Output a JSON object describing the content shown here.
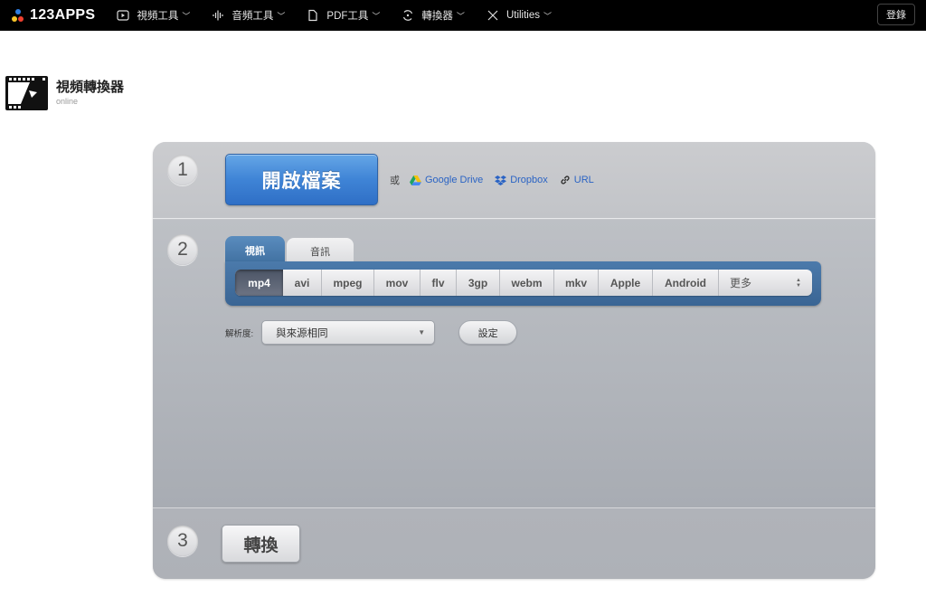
{
  "topbar": {
    "logo_text": "123APPS",
    "nav": [
      {
        "label": "視頻工具",
        "icon": "play-icon"
      },
      {
        "label": "音頻工具",
        "icon": "waveform-icon"
      },
      {
        "label": "PDF工具",
        "icon": "document-icon"
      },
      {
        "label": "轉換器",
        "icon": "convert-icon"
      },
      {
        "label": "Utilities",
        "icon": "tools-icon"
      }
    ],
    "login_label": "登錄"
  },
  "app": {
    "title": "視頻轉換器",
    "subtitle": "online"
  },
  "step1": {
    "number": "1",
    "open_label": "開啟檔案",
    "or_label": "或",
    "sources": [
      {
        "label": "Google Drive",
        "icon": "google-drive-icon"
      },
      {
        "label": "Dropbox",
        "icon": "dropbox-icon"
      },
      {
        "label": "URL",
        "icon": "link-icon"
      }
    ]
  },
  "step2": {
    "number": "2",
    "tabs": [
      {
        "label": "視訊",
        "active": true
      },
      {
        "label": "音訊",
        "active": false
      }
    ],
    "formats": [
      "mp4",
      "avi",
      "mpeg",
      "mov",
      "flv",
      "3gp",
      "webm",
      "mkv",
      "Apple",
      "Android"
    ],
    "active_format": "mp4",
    "more_label": "更多",
    "resolution_label": "解析度:",
    "resolution_value": "與來源相同",
    "settings_label": "設定"
  },
  "step3": {
    "number": "3",
    "convert_label": "轉換"
  },
  "colors": {
    "accent_blue": "#3f84d6",
    "tab_blue": "#4b7aab",
    "link_blue": "#2a63c4"
  }
}
